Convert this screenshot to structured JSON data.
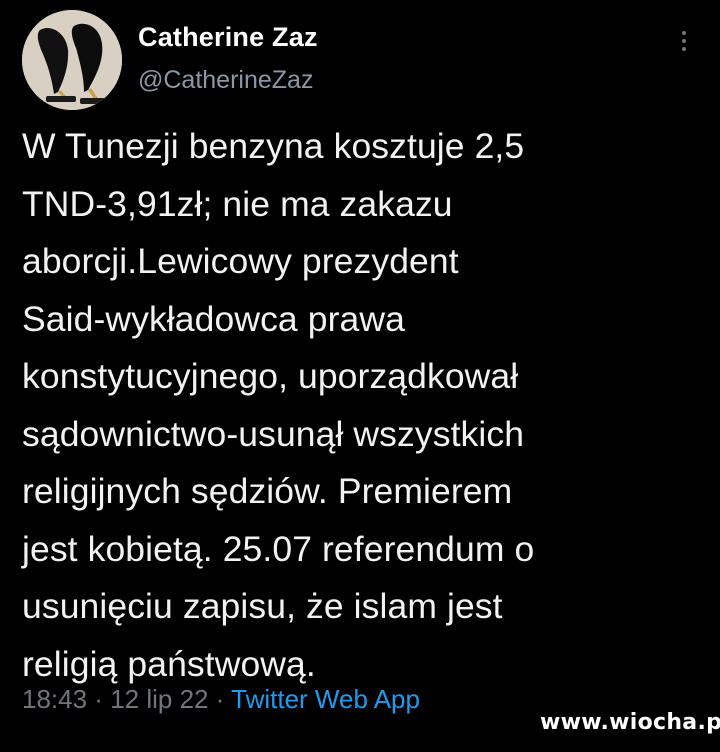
{
  "author": {
    "display_name": "Catherine Zaz",
    "handle": "@CatherineZaz",
    "avatar_icon": "avatar-shoes-image"
  },
  "tweet": {
    "lines": [
      "W Tunezji benzyna kosztuje 2,5",
      "TND-3,91zł; nie ma zakazu",
      "aborcji.Lewicowy prezydent",
      "Said-wykładowca prawa",
      "konstytucyjnego, uporządkował",
      "sądownictwo-usunął wszystkich",
      "religijnych sędziów. Premierem",
      "jest kobietą. 25.07 referendum o",
      "usunięciu zapisu, że islam jest",
      "religią państwową."
    ]
  },
  "meta": {
    "time": "18:43",
    "sep1": " · ",
    "date": "12 lip 22",
    "sep2": " · ",
    "app": "Twitter Web App"
  },
  "more_icon": "more-vertical-icon",
  "watermark": "www.wiocha.pl",
  "colors": {
    "background": "#000000",
    "text": "#f2f2f2",
    "secondary": "#71767b",
    "link": "#1d9bf0"
  }
}
